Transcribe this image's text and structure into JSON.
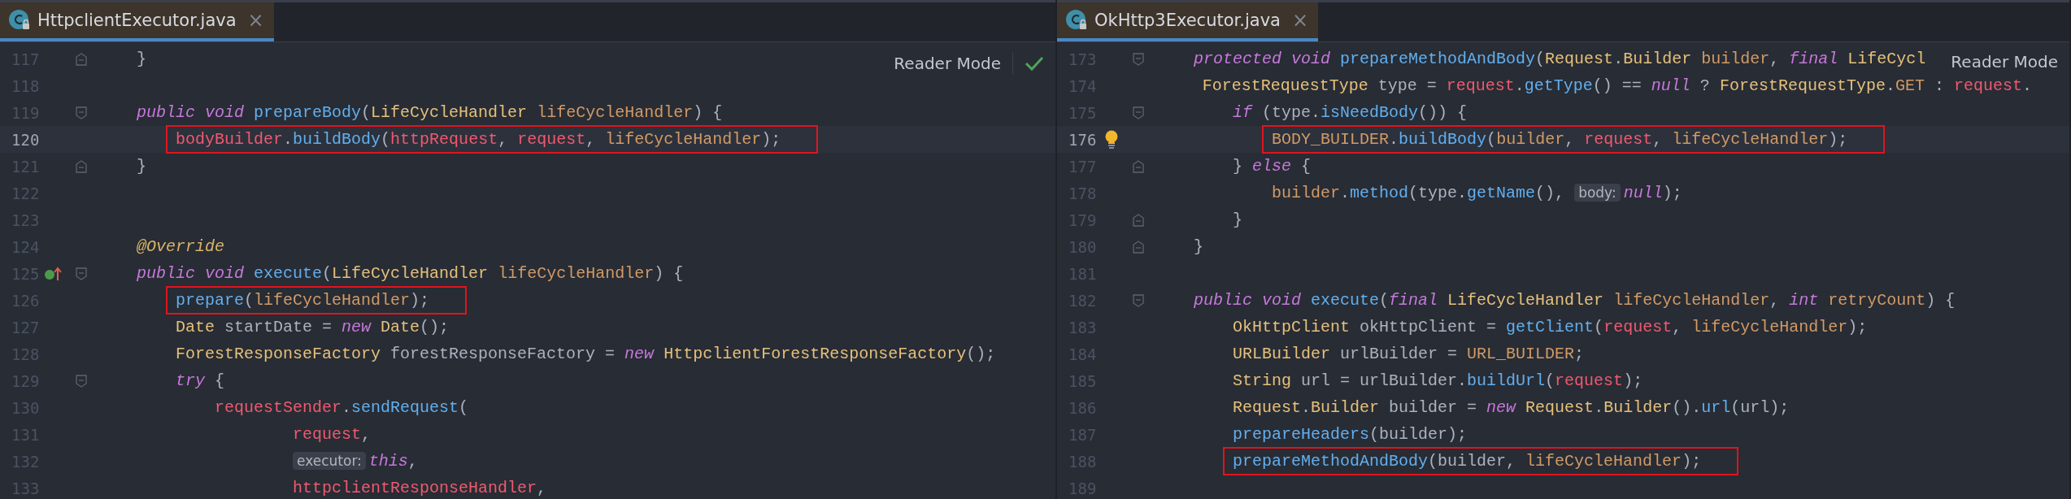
{
  "panes": [
    {
      "tab": {
        "title": "HttpclientExecutor.java",
        "selected": true,
        "close": "×"
      },
      "reader_mode": "Reader Mode",
      "inspection_ok": true,
      "lines": [
        {
          "number": "117",
          "fold": {
            "kind": "end"
          },
          "current": false,
          "highlighted": false,
          "tokens": [
            {
              "kind": "plain",
              "t": "    }"
            }
          ]
        },
        {
          "number": "118",
          "current": false
        },
        {
          "number": "119",
          "fold": {
            "kind": "start"
          },
          "current": false,
          "highlighted": false,
          "tokens": [
            {
              "kind": "kw",
              "t": "    public void "
            },
            {
              "kind": "fn",
              "t": "prepareBody"
            },
            {
              "kind": "plain",
              "t": "("
            },
            {
              "kind": "type",
              "t": "LifeCycleHandler "
            },
            {
              "kind": "param",
              "t": "lifeCycleHandler"
            },
            {
              "kind": "plain",
              "t": ") {"
            }
          ]
        },
        {
          "number": "120",
          "current": true,
          "highlighted": true,
          "tokens": [
            {
              "kind": "field",
              "t": "        bodyBuilder"
            },
            {
              "kind": "plain",
              "t": "."
            },
            {
              "kind": "fn",
              "t": "buildBody"
            },
            {
              "kind": "plain",
              "t": "("
            },
            {
              "kind": "field",
              "t": "httpRequest"
            },
            {
              "kind": "plain",
              "t": ", "
            },
            {
              "kind": "field",
              "t": "request"
            },
            {
              "kind": "plain",
              "t": ", "
            },
            {
              "kind": "param",
              "t": "lifeCycleHandler"
            },
            {
              "kind": "plain",
              "t": ");"
            }
          ]
        },
        {
          "number": "121",
          "fold": {
            "kind": "end"
          },
          "current": false,
          "highlighted": false,
          "tokens": [
            {
              "kind": "plain",
              "t": "    }"
            }
          ]
        },
        {
          "number": "122",
          "current": false
        },
        {
          "number": "123",
          "current": false
        },
        {
          "number": "124",
          "current": false,
          "highlighted": false,
          "tokens": [
            {
              "kind": "ann",
              "t": "    @Override"
            }
          ]
        },
        {
          "number": "125",
          "fold": {
            "kind": "start"
          },
          "marker": {
            "kind": "implements"
          },
          "current": false,
          "highlighted": false,
          "tokens": [
            {
              "kind": "kw",
              "t": "    public void "
            },
            {
              "kind": "fn",
              "t": "execute"
            },
            {
              "kind": "plain",
              "t": "("
            },
            {
              "kind": "type",
              "t": "LifeCycleHandler "
            },
            {
              "kind": "param",
              "t": "lifeCycleHandler"
            },
            {
              "kind": "plain",
              "t": ") {"
            }
          ]
        },
        {
          "number": "126",
          "current": false,
          "highlighted": true,
          "tokens": [
            {
              "kind": "fn",
              "t": "        prepare"
            },
            {
              "kind": "plain",
              "t": "("
            },
            {
              "kind": "param",
              "t": "lifeCycleHandler"
            },
            {
              "kind": "plain",
              "t": ");"
            }
          ]
        },
        {
          "number": "127",
          "current": false,
          "highlighted": false,
          "tokens": [
            {
              "kind": "type",
              "t": "        Date "
            },
            {
              "kind": "plain",
              "t": "startDate = "
            },
            {
              "kind": "kw",
              "t": "new "
            },
            {
              "kind": "type",
              "t": "Date"
            },
            {
              "kind": "plain",
              "t": "();"
            }
          ]
        },
        {
          "number": "128",
          "current": false,
          "highlighted": false,
          "tokens": [
            {
              "kind": "type",
              "t": "        ForestResponseFactory "
            },
            {
              "kind": "plain",
              "t": "forestResponseFactory = "
            },
            {
              "kind": "kw",
              "t": "new "
            },
            {
              "kind": "type",
              "t": "HttpclientForestResponseFactory"
            },
            {
              "kind": "plain",
              "t": "();"
            }
          ]
        },
        {
          "number": "129",
          "fold": {
            "kind": "start"
          },
          "current": false,
          "highlighted": false,
          "tokens": [
            {
              "kind": "kw",
              "t": "        try "
            },
            {
              "kind": "plain",
              "t": "{"
            }
          ]
        },
        {
          "number": "130",
          "current": false,
          "highlighted": false,
          "tokens": [
            {
              "kind": "field",
              "t": "            requestSender"
            },
            {
              "kind": "plain",
              "t": "."
            },
            {
              "kind": "fn",
              "t": "sendRequest"
            },
            {
              "kind": "plain",
              "t": "("
            }
          ]
        },
        {
          "number": "131",
          "current": false,
          "highlighted": false,
          "tokens": [
            {
              "kind": "field",
              "t": "                    request"
            },
            {
              "kind": "plain",
              "t": ","
            }
          ]
        },
        {
          "number": "132",
          "current": false,
          "highlighted": false,
          "tokens": [
            {
              "kind": "hint",
              "t": "                    executor:"
            },
            {
              "kind": "kw",
              "t": "this"
            },
            {
              "kind": "plain",
              "t": ","
            }
          ]
        },
        {
          "number": "133",
          "current": false,
          "highlighted": false,
          "tokens": [
            {
              "kind": "field",
              "t": "                    httpclientResponseHandler"
            },
            {
              "kind": "plain",
              "t": ","
            }
          ]
        }
      ]
    },
    {
      "tab": {
        "title": "OkHttp3Executor.java",
        "selected": true,
        "close": "×"
      },
      "reader_mode": "Reader Mode",
      "inspection_ok": false,
      "lines": [
        {
          "number": "173",
          "fold": {
            "kind": "start"
          },
          "current": false,
          "highlighted": false,
          "tokens": [
            {
              "kind": "kw",
              "t": "    protected void "
            },
            {
              "kind": "fn",
              "t": "prepareMethodAndBody"
            },
            {
              "kind": "plain",
              "t": "("
            },
            {
              "kind": "type",
              "t": "Request"
            },
            {
              "kind": "plain",
              "t": "."
            },
            {
              "kind": "type",
              "t": "Builder "
            },
            {
              "kind": "param",
              "t": "builder"
            },
            {
              "kind": "plain",
              "t": ", "
            },
            {
              "kind": "kw",
              "t": "final "
            },
            {
              "kind": "type",
              "t": "LifeCycl"
            }
          ]
        },
        {
          "number": "174",
          "current": false,
          "highlighted": false,
          "tokens": [
            {
              "kind": "type",
              "t": "        ForestRequestType "
            },
            {
              "kind": "plain",
              "t": "type = "
            },
            {
              "kind": "field",
              "t": "request"
            },
            {
              "kind": "plain",
              "t": "."
            },
            {
              "kind": "fn",
              "t": "getType"
            },
            {
              "kind": "plain",
              "t": "() == "
            },
            {
              "kind": "kw",
              "t": "null"
            },
            {
              "kind": "plain",
              "t": " ? "
            },
            {
              "kind": "type",
              "t": "ForestRequestType"
            },
            {
              "kind": "plain",
              "t": "."
            },
            {
              "kind": "param",
              "t": "GET"
            },
            {
              "kind": "plain",
              "t": " : "
            },
            {
              "kind": "field",
              "t": "request"
            },
            {
              "kind": "plain",
              "t": "."
            }
          ]
        },
        {
          "number": "175",
          "fold": {
            "kind": "start"
          },
          "current": false,
          "highlighted": false,
          "tokens": [
            {
              "kind": "kw",
              "t": "        if "
            },
            {
              "kind": "plain",
              "t": "(type."
            },
            {
              "kind": "fn",
              "t": "isNeedBody"
            },
            {
              "kind": "plain",
              "t": "()) {"
            }
          ]
        },
        {
          "number": "176",
          "marker": {
            "kind": "bulb"
          },
          "current": true,
          "highlighted": true,
          "tokens": [
            {
              "kind": "param",
              "t": "            BODY_BUILDER"
            },
            {
              "kind": "plain",
              "t": "."
            },
            {
              "kind": "fn",
              "t": "buildBody"
            },
            {
              "kind": "plain",
              "t": "("
            },
            {
              "kind": "param",
              "t": "builder"
            },
            {
              "kind": "plain",
              "t": ", "
            },
            {
              "kind": "field",
              "t": "request"
            },
            {
              "kind": "plain",
              "t": ", "
            },
            {
              "kind": "param",
              "t": "lifeCycleHandler"
            },
            {
              "kind": "plain",
              "t": ");"
            }
          ]
        },
        {
          "number": "177",
          "fold": {
            "kind": "end"
          },
          "current": false,
          "highlighted": false,
          "tokens": [
            {
              "kind": "plain",
              "t": "        } "
            },
            {
              "kind": "kw",
              "t": "else "
            },
            {
              "kind": "plain",
              "t": "{"
            }
          ]
        },
        {
          "number": "178",
          "current": false,
          "highlighted": false,
          "tokens": [
            {
              "kind": "param",
              "t": "            builder"
            },
            {
              "kind": "plain",
              "t": "."
            },
            {
              "kind": "fn",
              "t": "method"
            },
            {
              "kind": "plain",
              "t": "(type."
            },
            {
              "kind": "fn",
              "t": "getName"
            },
            {
              "kind": "plain",
              "t": "(), "
            },
            {
              "kind": "hint",
              "t": "body:"
            },
            {
              "kind": "kw",
              "t": "null"
            },
            {
              "kind": "plain",
              "t": ");"
            }
          ]
        },
        {
          "number": "179",
          "fold": {
            "kind": "end"
          },
          "current": false,
          "highlighted": false,
          "tokens": [
            {
              "kind": "plain",
              "t": "        }"
            }
          ]
        },
        {
          "number": "180",
          "fold": {
            "kind": "end"
          },
          "current": false,
          "highlighted": false,
          "tokens": [
            {
              "kind": "plain",
              "t": "    }"
            }
          ]
        },
        {
          "number": "181",
          "current": false
        },
        {
          "number": "182",
          "fold": {
            "kind": "start"
          },
          "current": false,
          "highlighted": false,
          "tokens": [
            {
              "kind": "kw",
              "t": "    public void "
            },
            {
              "kind": "fn",
              "t": "execute"
            },
            {
              "kind": "plain",
              "t": "("
            },
            {
              "kind": "kw",
              "t": "final "
            },
            {
              "kind": "type",
              "t": "LifeCycleHandler "
            },
            {
              "kind": "param",
              "t": "lifeCycleHandler"
            },
            {
              "kind": "plain",
              "t": ", "
            },
            {
              "kind": "kw",
              "t": "int "
            },
            {
              "kind": "param",
              "t": "retryCount"
            },
            {
              "kind": "plain",
              "t": ") {"
            }
          ]
        },
        {
          "number": "183",
          "current": false,
          "highlighted": false,
          "tokens": [
            {
              "kind": "type",
              "t": "        OkHttpClient "
            },
            {
              "kind": "plain",
              "t": "okHttpClient = "
            },
            {
              "kind": "fn",
              "t": "getClient"
            },
            {
              "kind": "plain",
              "t": "("
            },
            {
              "kind": "field",
              "t": "request"
            },
            {
              "kind": "plain",
              "t": ", "
            },
            {
              "kind": "param",
              "t": "lifeCycleHandler"
            },
            {
              "kind": "plain",
              "t": ");"
            }
          ]
        },
        {
          "number": "184",
          "current": false,
          "highlighted": false,
          "tokens": [
            {
              "kind": "type",
              "t": "        URLBuilder "
            },
            {
              "kind": "plain",
              "t": "urlBuilder = "
            },
            {
              "kind": "param",
              "t": "URL_BUILDER"
            },
            {
              "kind": "plain",
              "t": ";"
            }
          ]
        },
        {
          "number": "185",
          "current": false,
          "highlighted": false,
          "tokens": [
            {
              "kind": "type",
              "t": "        String "
            },
            {
              "kind": "plain",
              "t": "url = urlBuilder."
            },
            {
              "kind": "fn",
              "t": "buildUrl"
            },
            {
              "kind": "plain",
              "t": "("
            },
            {
              "kind": "field",
              "t": "request"
            },
            {
              "kind": "plain",
              "t": ");"
            }
          ]
        },
        {
          "number": "186",
          "current": false,
          "highlighted": false,
          "tokens": [
            {
              "kind": "type",
              "t": "        Request"
            },
            {
              "kind": "plain",
              "t": "."
            },
            {
              "kind": "type",
              "t": "Builder "
            },
            {
              "kind": "plain",
              "t": "builder = "
            },
            {
              "kind": "kw",
              "t": "new "
            },
            {
              "kind": "type",
              "t": "Request"
            },
            {
              "kind": "plain",
              "t": "."
            },
            {
              "kind": "type",
              "t": "Builder"
            },
            {
              "kind": "plain",
              "t": "()."
            },
            {
              "kind": "fn",
              "t": "url"
            },
            {
              "kind": "plain",
              "t": "(url);"
            }
          ]
        },
        {
          "number": "187",
          "current": false,
          "highlighted": false,
          "tokens": [
            {
              "kind": "fn",
              "t": "        prepareHeaders"
            },
            {
              "kind": "plain",
              "t": "(builder);"
            }
          ]
        },
        {
          "number": "188",
          "current": false,
          "highlighted": true,
          "tokens": [
            {
              "kind": "fn",
              "t": "        prepareMethodAndBody"
            },
            {
              "kind": "plain",
              "t": "(builder, "
            },
            {
              "kind": "param",
              "t": "lifeCycleHandler"
            },
            {
              "kind": "plain",
              "t": ");"
            }
          ]
        },
        {
          "number": "189",
          "current": false
        }
      ]
    }
  ]
}
